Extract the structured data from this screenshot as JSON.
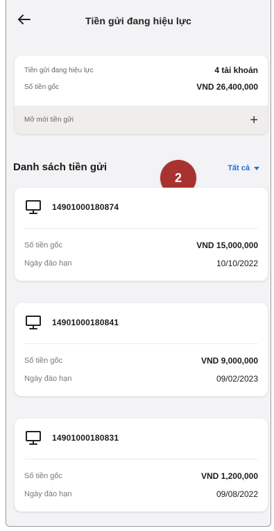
{
  "header": {
    "title": "Tiền gửi đang hiệu lực"
  },
  "summary": {
    "active_label": "Tiền gửi đang hiệu lực",
    "active_value": "4 tài khoản",
    "principal_label": "Số tiền gốc",
    "principal_value": "VND 26,400,000",
    "open_new_label": "Mở mới tiền gửi"
  },
  "list": {
    "title": "Danh sách tiền gửi",
    "filter_label": "Tất cả",
    "deposits": [
      {
        "account": "14901000180874",
        "principal_label": "Số tiền gốc",
        "principal": "VND 15,000,000",
        "maturity_label": "Ngày đáo hạn",
        "maturity": "10/10/2022"
      },
      {
        "account": "14901000180841",
        "principal_label": "Số tiền gốc",
        "principal": "VND 9,000,000",
        "maturity_label": "Ngày đáo hạn",
        "maturity": "09/02/2023"
      },
      {
        "account": "14901000180831",
        "principal_label": "Số tiền gốc",
        "principal": "VND 1,200,000",
        "maturity_label": "Ngày đáo hạn",
        "maturity": "09/08/2022"
      }
    ]
  },
  "annotation": {
    "badge_number": "2",
    "badge_color": "#a8322f"
  },
  "colors": {
    "accent": "#1f6fd8",
    "background": "#f3f3f5"
  },
  "icons": {
    "back": "arrow-left-icon",
    "add": "plus-icon",
    "deposit": "monitor-icon",
    "filter": "caret-down-icon"
  }
}
